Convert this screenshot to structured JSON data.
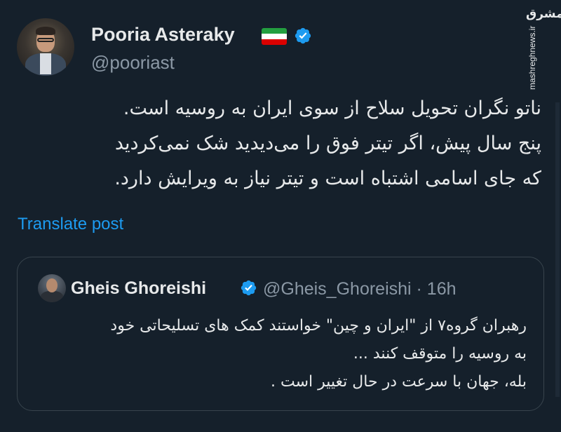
{
  "author": {
    "name": "Pooria Asteraky",
    "handle": "@pooriast",
    "flag_colors": [
      "#239f40",
      "#ffffff",
      "#da0000"
    ]
  },
  "watermark": {
    "logo": "مشرق",
    "site": "mashreghnews.ir"
  },
  "tweet": {
    "lines": [
      "ناتو نگران تحویل سلاح از سوی ایران به روسیه است.",
      "پنج سال پیش، اگر تیتر فوق را می‌دیدید شک نمی‌کردید",
      "که جای اسامی اشتباه است و تیتر نیاز به ویرایش دارد."
    ],
    "translate_label": "Translate post"
  },
  "quote": {
    "name": "Gheis Ghoreishi",
    "handle_time": "@Gheis_Ghoreishi · 16h",
    "lines": [
      "رهبران گروه۷ از \"ایران و چین\" خواستند کمک های تسلیحاتی خود",
      "به روسیه را متوقف کنند ...",
      "بله، جهان با سرعت در حال تغییر است ."
    ]
  },
  "colors": {
    "background": "#15202b",
    "accent": "#1d9bf0",
    "secondary_text": "#8b98a5",
    "border": "#38444d"
  }
}
